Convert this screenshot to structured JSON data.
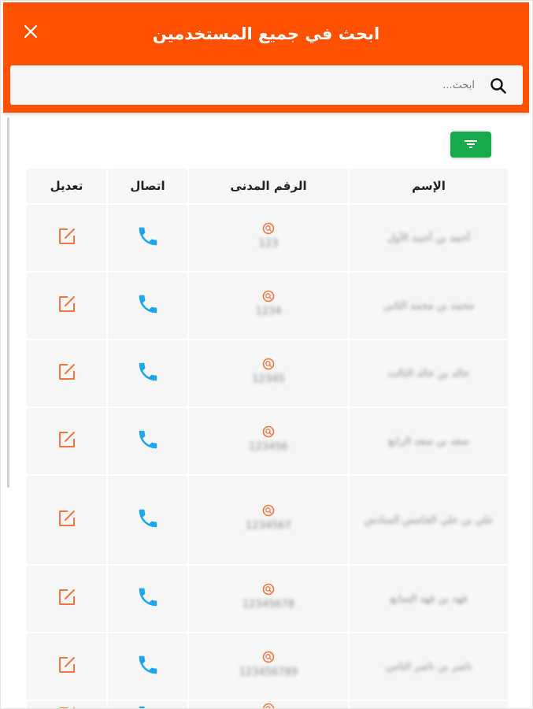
{
  "header": {
    "title": "ابحث في جميع المستخدمين",
    "close_glyph": "×",
    "brand_color": "#ff5100"
  },
  "search": {
    "placeholder": "ابحث...",
    "value": "",
    "icon": "search-icon"
  },
  "filter": {
    "icon": "filter-icon",
    "color": "#18a94b"
  },
  "table": {
    "columns": {
      "name": "الإسم",
      "civil_id": "الرقم المدنى",
      "call": "اتصال",
      "edit": "تعديل"
    },
    "rows": [
      {
        "name": "أحمد بن أحمد الأول",
        "civil_id": "123",
        "height": 84
      },
      {
        "name": "محمد بن محمد الثاني",
        "civil_id": "1234",
        "height": 84
      },
      {
        "name": "خالد بن خالد الثالث",
        "civil_id": "12345",
        "height": 84
      },
      {
        "name": "سعد بن سعد الرابع",
        "civil_id": "123456",
        "height": 84
      },
      {
        "name": "علي بن علي الخامس السادس",
        "civil_id": "1234567",
        "height": 112
      },
      {
        "name": "فهد بن فهد السابع",
        "civil_id": "12345678",
        "height": 84
      },
      {
        "name": "ناصر بن ناصر الثامن",
        "civil_id": "123456789",
        "height": 84
      },
      {
        "name": "",
        "civil_id": "",
        "height": 40
      }
    ],
    "row_icons": [
      "search-icon",
      "phone-icon",
      "edit-icon"
    ],
    "call_color": "#1ca6f2",
    "edit_color": "#f07740"
  }
}
